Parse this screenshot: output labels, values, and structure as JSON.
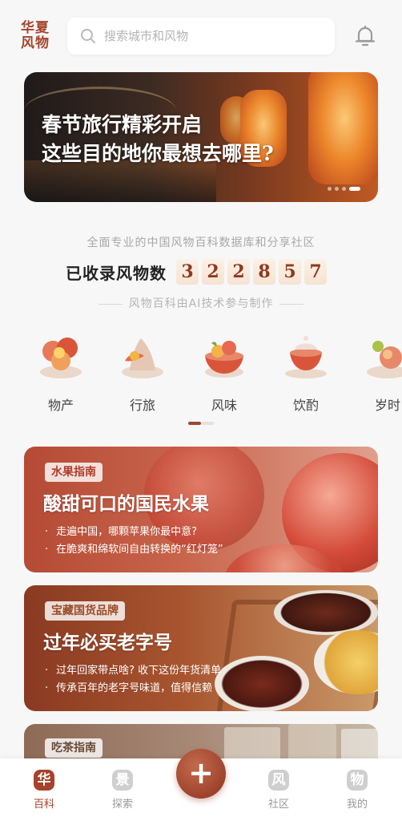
{
  "header": {
    "logo_text": "华夏风物",
    "search_placeholder": "搜索城市和风物"
  },
  "banner": {
    "title_line1": "春节旅行精彩开启",
    "title_line2": "这些目的地你最想去哪里?"
  },
  "stats": {
    "tagline": "全面专业的中国风物百科数据库和分享社区",
    "count_label": "已收录风物数",
    "digits": [
      "3",
      "2",
      "2",
      "8",
      "5",
      "7"
    ],
    "ai_note": "风物百科由AI技术参与制作"
  },
  "categories": [
    {
      "label": "物产"
    },
    {
      "label": "行旅"
    },
    {
      "label": "风味"
    },
    {
      "label": "饮酌"
    },
    {
      "label": "岁时"
    }
  ],
  "cards": [
    {
      "tag": "水果指南",
      "title": "酸甜可口的国民水果",
      "bullets": [
        "走遍中国，哪颗苹果你最中意?",
        "在脆爽和绵软间自由转换的“红灯笼”"
      ]
    },
    {
      "tag": "宝藏国货品牌",
      "title": "过年必买老字号",
      "bullets": [
        "过年回家带点啥? 收下这份年货清单",
        "传承百年的老字号味道，值得信赖"
      ]
    },
    {
      "tag": "吃茶指南"
    }
  ],
  "tabbar": {
    "items": [
      {
        "icon_char": "华",
        "label": "百科",
        "active": true
      },
      {
        "icon_char": "景",
        "label": "探索",
        "active": false
      },
      {
        "icon_char": "风",
        "label": "社区",
        "active": false
      },
      {
        "icon_char": "物",
        "label": "我的",
        "active": false
      }
    ],
    "fab_symbol": "+"
  },
  "colors": {
    "brand": "#a6432a",
    "digit_bg": "#f6e3d2",
    "inactive_icon": "#cfcfcf"
  }
}
